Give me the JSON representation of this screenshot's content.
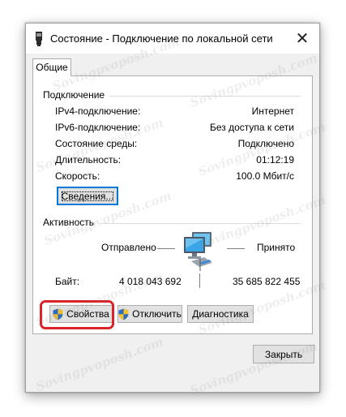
{
  "window": {
    "title": "Состояние - Подключение по локальной сети",
    "close_glyph": "✕"
  },
  "tabs": [
    {
      "label": "Общие",
      "active": true
    }
  ],
  "connection": {
    "group_title": "Подключение",
    "rows": [
      {
        "label": "IPv4-подключение:",
        "value": "Интернет"
      },
      {
        "label": "IPv6-подключение:",
        "value": "Без доступа к сети"
      },
      {
        "label": "Состояние среды:",
        "value": "Подключено"
      },
      {
        "label": "Длительность:",
        "value": "01:12:19"
      },
      {
        "label": "Скорость:",
        "value": "100.0 Мбит/с"
      }
    ],
    "details_button": "Сведения..."
  },
  "activity": {
    "group_title": "Активность",
    "sent_label": "Отправлено",
    "received_label": "Принято",
    "bytes_label": "Байт:",
    "bytes_sent": "4 018 043 692",
    "bytes_received": "35 685 822 455"
  },
  "actions": {
    "properties": "Свойства",
    "disable": "Отключить",
    "diagnose": "Диагностика"
  },
  "footer": {
    "close_button": "Закрыть"
  },
  "watermark_text": "Sovingpvoposh.com",
  "colors": {
    "accent": "#0078d7",
    "highlight": "#d9242b",
    "dialog_bg": "#f0f0f0"
  }
}
